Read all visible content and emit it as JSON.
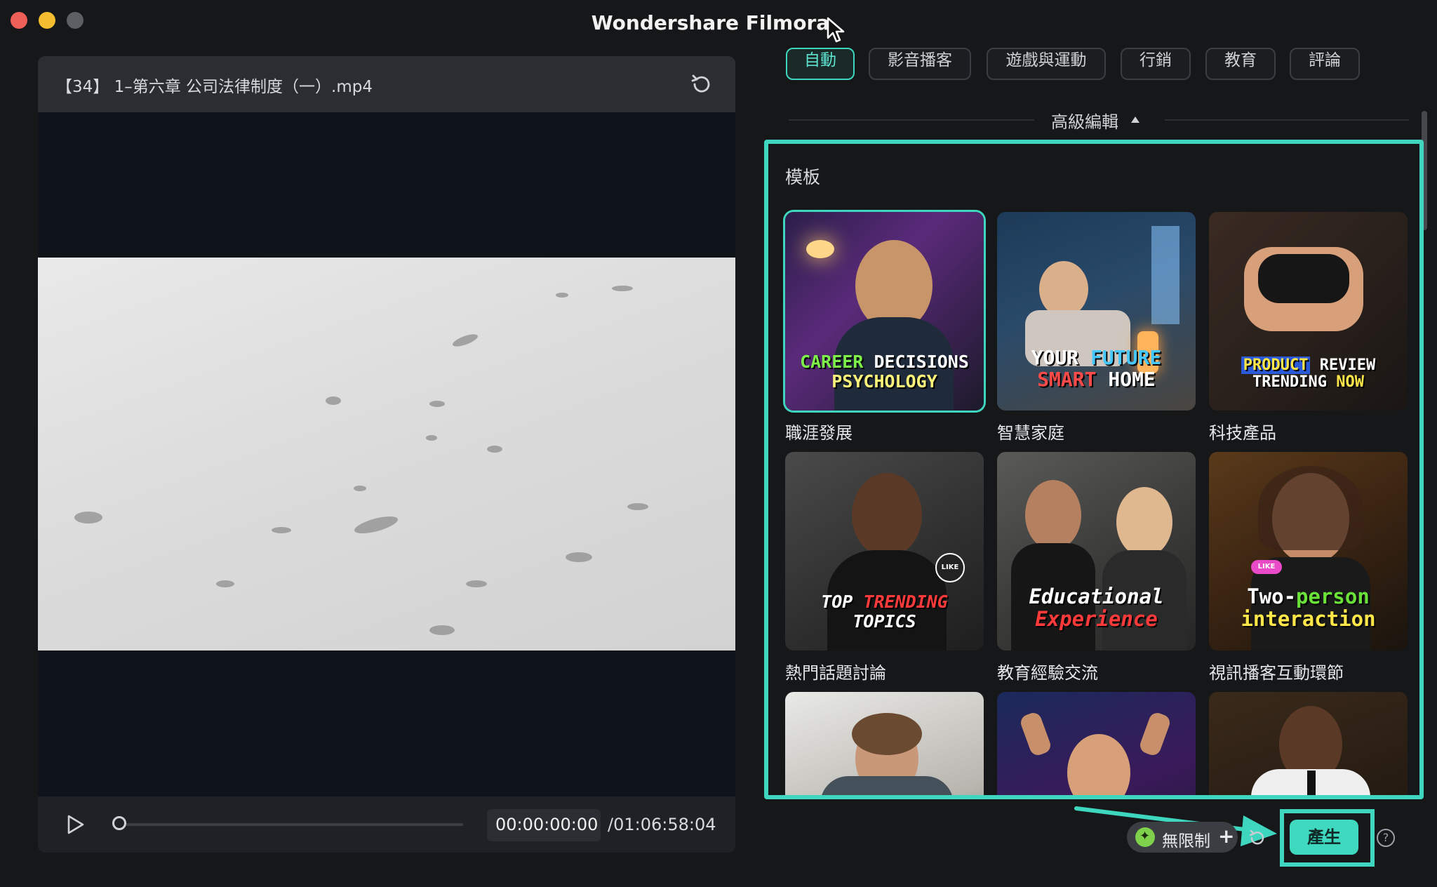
{
  "app": {
    "title": "Wondershare Filmora"
  },
  "player": {
    "filename": "【34】 1–第六章 公司法律制度（一）.mp4",
    "current_time": "00:00:00:00",
    "total_time": "/01:06:58:04",
    "progress": 0
  },
  "category_tabs": [
    {
      "label": "自動",
      "active": true
    },
    {
      "label": "影音播客",
      "active": false
    },
    {
      "label": "遊戲與運動",
      "active": false
    },
    {
      "label": "行銷",
      "active": false
    },
    {
      "label": "教育",
      "active": false
    },
    {
      "label": "評論",
      "active": false
    }
  ],
  "advanced": {
    "label": "高級編輯"
  },
  "templates": {
    "title": "模板",
    "items": [
      {
        "caption": "職涯發展",
        "line1a": "CAREER",
        "line1b": "DECISIONS",
        "line2": "PSYCHOLOGY",
        "selected": true
      },
      {
        "caption": "智慧家庭",
        "line1a": "YOUR",
        "line1b": "FUTURE",
        "line2a": "SMART",
        "line2b": "HOME",
        "selected": false
      },
      {
        "caption": "科技產品",
        "line1a": "PRODUCT",
        "line1b": "REVIEW",
        "line2a": "TRENDING",
        "line2b": "NOW",
        "selected": false
      },
      {
        "caption": "熱門話題討論",
        "line1a": "TOP",
        "line1b": "TRENDING",
        "line2": "TOPICS",
        "badge": "LIKE",
        "selected": false
      },
      {
        "caption": "教育經驗交流",
        "line1": "Educational",
        "line2": "Experience",
        "selected": false
      },
      {
        "caption": "視訊播客互動環節",
        "line1a": "Two-",
        "line1b": "person",
        "line2": "interaction",
        "badge": "LIKE",
        "selected": false
      }
    ]
  },
  "footer": {
    "unlimited_label": "無限制",
    "plus": "+",
    "generate_label": "產生",
    "help": "?"
  },
  "colors": {
    "accent": "#3ed6bf",
    "background": "#151719"
  }
}
